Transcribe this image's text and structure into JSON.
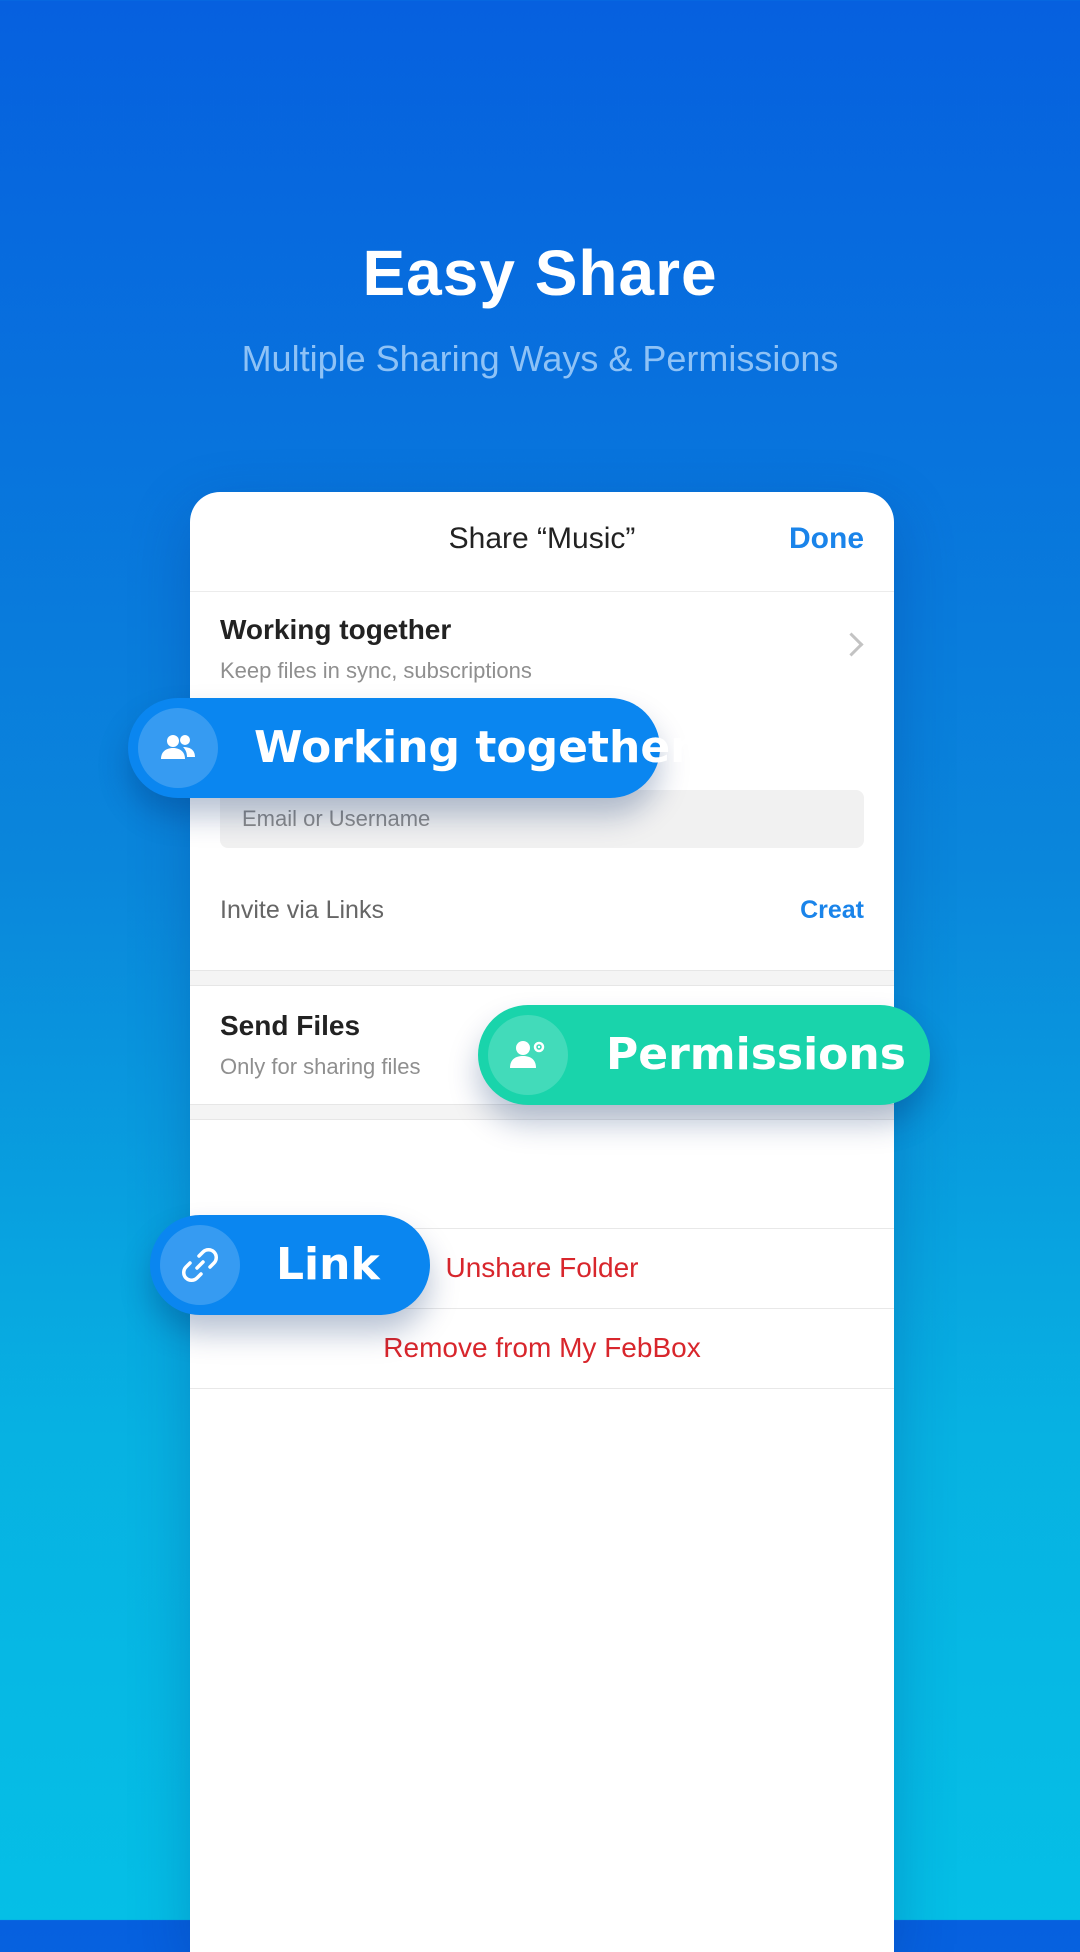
{
  "hero": {
    "title": "Easy Share",
    "subtitle": "Multiple Sharing Ways & Permissions"
  },
  "dialog": {
    "title": "Share “Music”",
    "done_label": "Done",
    "working_together": {
      "title": "Working together",
      "subtitle": "Keep files in sync, subscriptions"
    },
    "email_placeholder": "Email or Username",
    "invite_label": "Invite via Links",
    "creat_label": "Creat",
    "send_files": {
      "title": "Send Files",
      "subtitle": "Only for sharing files"
    },
    "unshare_label": "Unshare Folder",
    "remove_label": "Remove from My FebBox"
  },
  "badges": {
    "working_together": {
      "label": "Working together",
      "icon": "people-icon"
    },
    "permissions": {
      "label": "Permissions",
      "icon": "user-settings-icon"
    },
    "link": {
      "label": "Link",
      "icon": "link-icon"
    }
  },
  "colors": {
    "accent_blue": "#1a84ea",
    "pill_blue": "#0a86f0",
    "pill_green": "#19d4ab",
    "destructive_red": "#d8262c"
  }
}
